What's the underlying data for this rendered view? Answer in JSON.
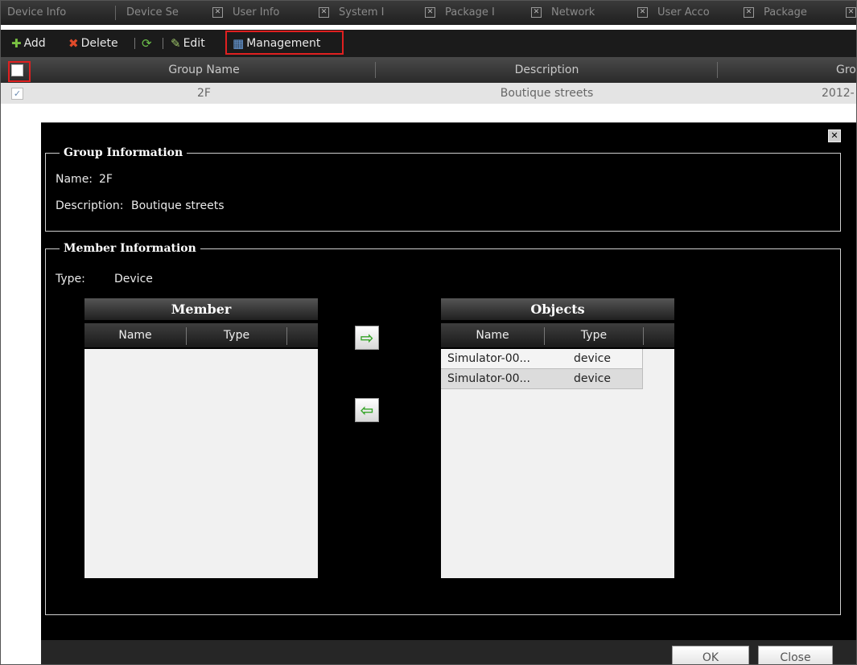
{
  "tabs": [
    {
      "label": "Device Info"
    },
    {
      "label": "Device Se"
    },
    {
      "label": "User Info"
    },
    {
      "label": "System I"
    },
    {
      "label": "Package I"
    },
    {
      "label": "Network"
    },
    {
      "label": "User Acco"
    },
    {
      "label": "Package"
    }
  ],
  "toolbar": {
    "add_label": "Add",
    "delete_label": "Delete",
    "edit_label": "Edit",
    "management_label": "Management"
  },
  "grid": {
    "columns": [
      "Group Name",
      "Description",
      "Gro"
    ],
    "rows": [
      {
        "name": "2F",
        "description": "Boutique streets",
        "group": "2012-"
      }
    ]
  },
  "modal": {
    "group_info": {
      "legend": "Group Information",
      "name_label": "Name:",
      "name_value": "2F",
      "description_label": "Description:",
      "description_value": "Boutique streets"
    },
    "member_info": {
      "legend": "Member Information",
      "type_label": "Type:",
      "type_value": "Device"
    },
    "member_panel": {
      "title": "Member",
      "columns": [
        "Name",
        "Type"
      ],
      "rows": []
    },
    "objects_panel": {
      "title": "Objects",
      "columns": [
        "Name",
        "Type"
      ],
      "rows": [
        {
          "name": "Simulator-00...",
          "type": "device"
        },
        {
          "name": "Simulator-00...",
          "type": "device"
        }
      ]
    },
    "buttons": {
      "ok": "OK",
      "close": "Close"
    }
  },
  "colors": {
    "highlight_border": "#e02020",
    "arrow_green": "#38a52a"
  }
}
